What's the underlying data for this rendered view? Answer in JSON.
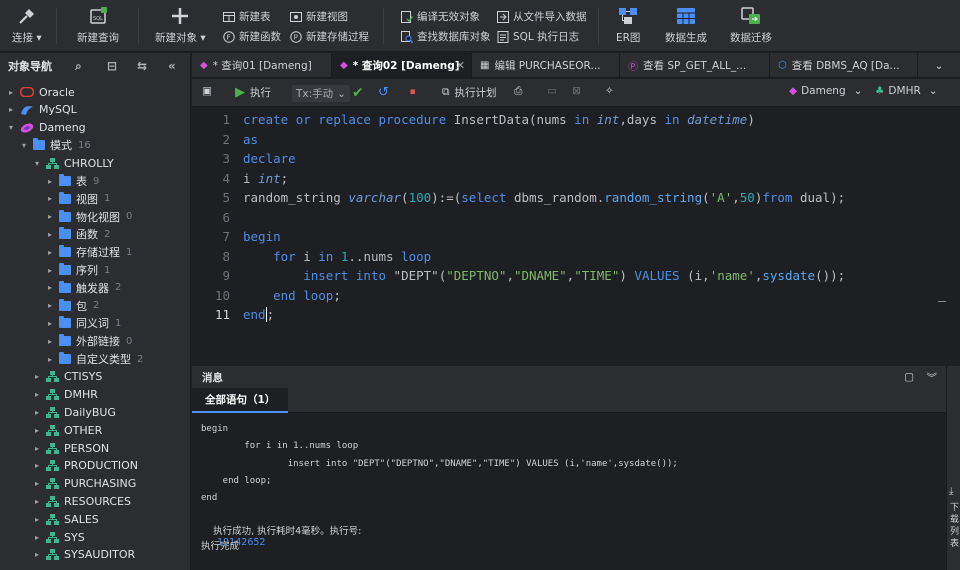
{
  "toolbar": {
    "connect": "连接",
    "new_query": "新建查询",
    "new_object": "新建对象",
    "new_table": "新建表",
    "new_function": "新建函数",
    "new_view": "新建视图",
    "new_procedure": "新建存储过程",
    "compile_invalid": "编译无效对象",
    "find_db_object": "查找数据库对象",
    "import_from_file": "从文件导入数据",
    "sql_exec_log": "SQL 执行日志",
    "er_diagram": "ER图",
    "data_generate": "数据生成",
    "data_migrate": "数据迁移"
  },
  "nav": {
    "title": "对象导航",
    "connections": [
      {
        "label": "Oracle"
      },
      {
        "label": "MySQL"
      },
      {
        "label": "Dameng"
      }
    ],
    "schema_folder": {
      "label": "模式",
      "count": "16"
    },
    "current_schema": "CHROLLY",
    "folders": [
      {
        "label": "表",
        "count": "9"
      },
      {
        "label": "视图",
        "count": "1"
      },
      {
        "label": "物化视图",
        "count": "0"
      },
      {
        "label": "函数",
        "count": "2"
      },
      {
        "label": "存储过程",
        "count": "1"
      },
      {
        "label": "序列",
        "count": "1"
      },
      {
        "label": "触发器",
        "count": "2"
      },
      {
        "label": "包",
        "count": "2"
      },
      {
        "label": "同义词",
        "count": "1"
      },
      {
        "label": "外部链接",
        "count": "0"
      },
      {
        "label": "自定义类型",
        "count": "2"
      }
    ],
    "schemas": [
      "CTISYS",
      "DMHR",
      "DailyBUG",
      "OTHER",
      "PERSON",
      "PRODUCTION",
      "PURCHASING",
      "RESOURCES",
      "SALES",
      "SYS",
      "SYSAUDITOR"
    ]
  },
  "tabs": [
    {
      "label": "* 查询01 [Dameng]"
    },
    {
      "label": "* 查询02 [Dameng]"
    },
    {
      "label": "编辑 PURCHASEOR..."
    },
    {
      "label": "查看 SP_GET_ALL_..."
    },
    {
      "label": "查看 DBMS_AQ [Da..."
    }
  ],
  "editor_toolbar": {
    "run": "执行",
    "tx_mode": "Tx:手动",
    "explain": "执行计划",
    "connection": "Dameng",
    "schema": "DMHR"
  },
  "editor": {
    "line_numbers": [
      "1",
      "2",
      "3",
      "4",
      "5",
      "6",
      "7",
      "8",
      "9",
      "10",
      "11"
    ]
  },
  "messages": {
    "header": "消息",
    "tab_label": "全部语句（1）",
    "lines": [
      "begin",
      "        for i in 1..nums loop",
      "                insert into \"DEPT\"(\"DEPTNO\",\"DNAME\",\"TIME\") VALUES (i,'name',sysdate());",
      "    end loop;",
      "end"
    ],
    "result_prefix": "执行成功, 执行耗时4毫秒。执行号:",
    "exec_id": "19142652",
    "done": "执行完成"
  },
  "side_panel": {
    "label": "下载列表"
  },
  "colors": {
    "accent": "#4a8ff5",
    "keyword": "#4d8fe6",
    "string": "#7fb96a",
    "number": "#2aacb8",
    "run": "#4caf50"
  }
}
